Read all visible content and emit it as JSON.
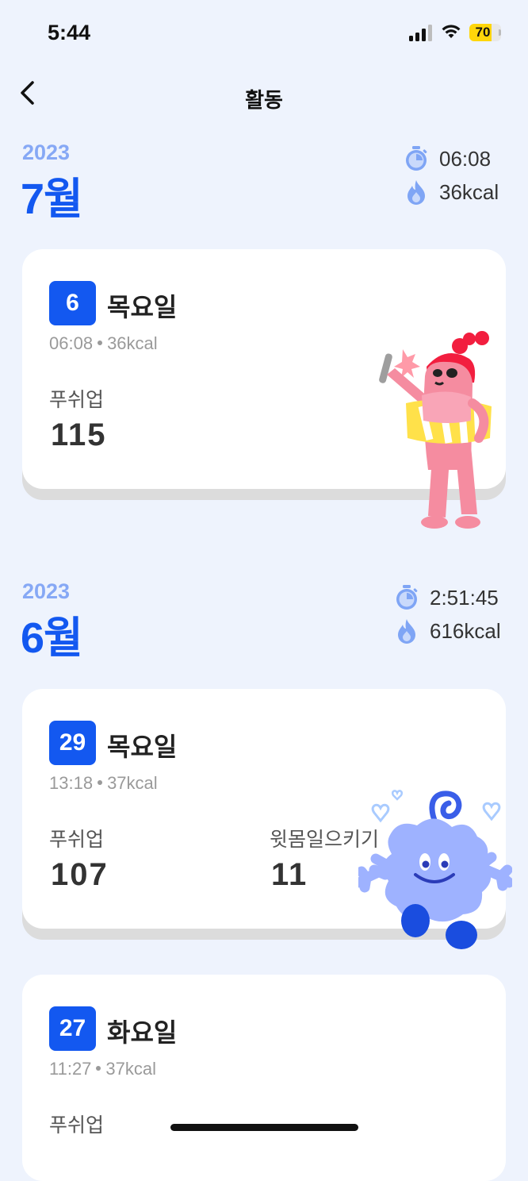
{
  "status_bar": {
    "time": "5:44",
    "battery": "70",
    "battery_level": 0.7
  },
  "header": {
    "title": "활동"
  },
  "months": [
    {
      "year": "2023",
      "month": "7월",
      "duration": "06:08",
      "calories": "36kcal",
      "days": [
        {
          "day": "6",
          "weekday": "목요일",
          "time": "06:08",
          "calories": "36kcal",
          "exercises": [
            {
              "name": "푸쉬업",
              "count": "115"
            }
          ]
        }
      ]
    },
    {
      "year": "2023",
      "month": "6월",
      "duration": "2:51:45",
      "calories": "616kcal",
      "days": [
        {
          "day": "29",
          "weekday": "목요일",
          "time": "13:18",
          "calories": "37kcal",
          "exercises": [
            {
              "name": "푸쉬업",
              "count": "107"
            },
            {
              "name": "윗몸일으키기",
              "count": "11"
            }
          ]
        },
        {
          "day": "27",
          "weekday": "화요일",
          "time": "11:27",
          "calories": "37kcal",
          "exercises": [
            {
              "name": "푸쉬업",
              "count": ""
            }
          ]
        }
      ]
    }
  ],
  "icons": {
    "timer": "stopwatch-icon",
    "flame": "flame-icon",
    "back": "chevron-left-icon"
  },
  "colors": {
    "accent": "#1358F0",
    "year": "#86A8F5",
    "background": "#EEF3FD",
    "icon": "#7FA5F5"
  }
}
